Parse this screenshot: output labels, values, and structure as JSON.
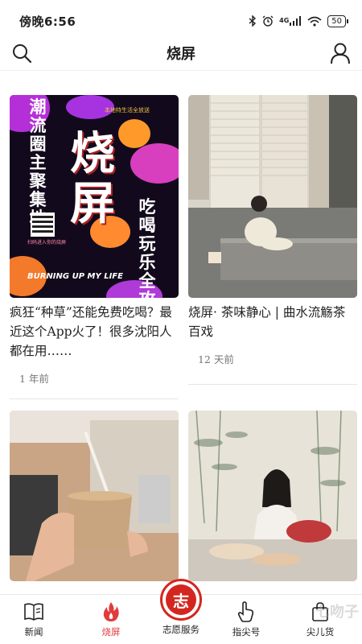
{
  "status_bar": {
    "time": "傍晚6:56",
    "network": "4G",
    "battery": "50"
  },
  "header": {
    "title": "烧屏"
  },
  "feed": [
    {
      "title": "疯狂“种草”还能免费吃喝？最近这个App火了！很多沈阳人都在用……",
      "time": "1 年前",
      "poster": {
        "tagline": "本地特生活全放送",
        "left_vertical": "潮流圈主聚集地",
        "big_text": "烧屏",
        "right_vertical": "吃喝玩乐全攻略",
        "qr_caption": "扫码进入你的烧屏",
        "footer": "BURNING UP MY LIFE"
      }
    },
    {
      "title": "烧屏· 茶味静心 | 曲水流觞茶百戏",
      "time": "12 天前"
    },
    {
      "title": "",
      "time": ""
    },
    {
      "title": "",
      "time": ""
    }
  ],
  "tabbar": {
    "items": [
      {
        "label": "新闻",
        "icon": "book-icon"
      },
      {
        "label": "烧屏",
        "icon": "flame-icon",
        "active": true
      },
      {
        "label": "志愿服务",
        "icon": "volunteer-emblem-icon"
      },
      {
        "label": "指尖号",
        "icon": "pointer-hand-icon"
      },
      {
        "label": "尖儿货",
        "icon": "shopping-bag-icon"
      }
    ],
    "emblem_char": "志"
  },
  "watermark": "七吻子",
  "colors": {
    "accent": "#e03c3c",
    "emblem": "#d3261f"
  }
}
